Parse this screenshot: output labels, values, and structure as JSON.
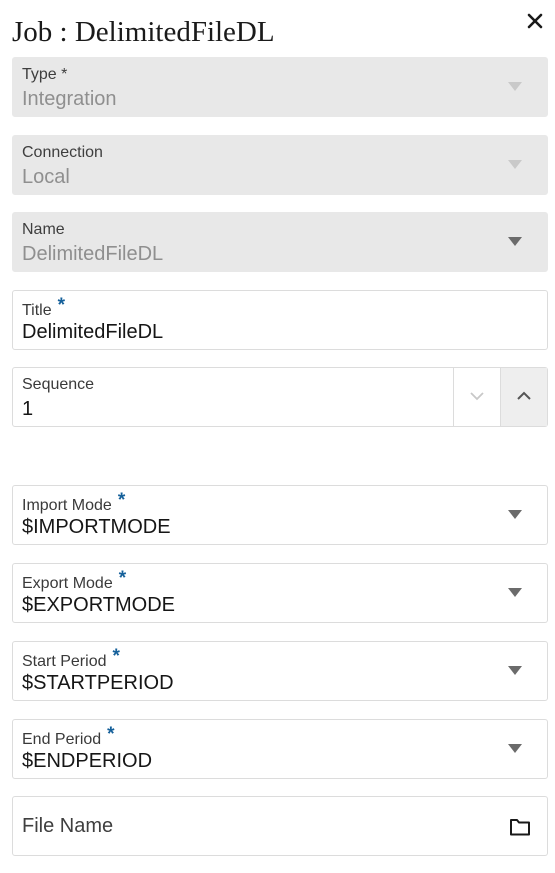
{
  "header": {
    "title": "Job : DelimitedFileDL",
    "close_icon": "close-icon"
  },
  "fields": {
    "type": {
      "label": "Type *",
      "value": "Integration"
    },
    "connection": {
      "label": "Connection",
      "value": "Local"
    },
    "name": {
      "label": "Name",
      "value": "DelimitedFileDL"
    },
    "title": {
      "label": "Title",
      "required_mark": "*",
      "value": "DelimitedFileDL"
    },
    "sequence": {
      "label": "Sequence",
      "value": "1"
    },
    "import_mode": {
      "label": "Import Mode",
      "required_mark": "*",
      "value": "$IMPORTMODE"
    },
    "export_mode": {
      "label": "Export Mode",
      "required_mark": "*",
      "value": "$EXPORTMODE"
    },
    "start_period": {
      "label": "Start Period",
      "required_mark": "*",
      "value": "$STARTPERIOD"
    },
    "end_period": {
      "label": "End Period",
      "required_mark": "*",
      "value": "$ENDPERIOD"
    },
    "file_name": {
      "placeholder": "File Name"
    }
  },
  "colors": {
    "required_accent": "#15609a",
    "disabled_bg": "#e8e8e8",
    "disabled_text": "#8f8f8f",
    "border": "#dcdcdc"
  },
  "icons": {
    "dropdown": "chevron-down-icon",
    "decrement": "chevron-down-icon",
    "increment": "chevron-up-icon",
    "browse": "folder-icon"
  }
}
